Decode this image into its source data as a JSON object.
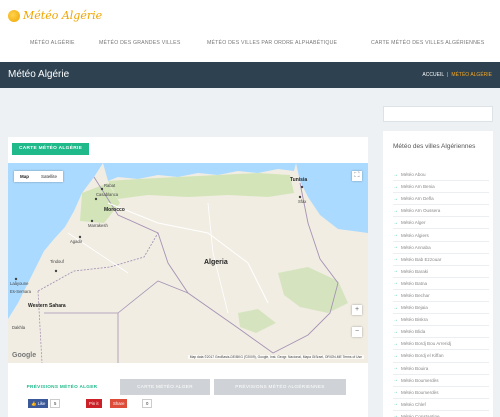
{
  "site": {
    "logo_text": "Météo Algérie"
  },
  "nav": [
    "MÉTÉO ALGÉRIE",
    "MÉTÉO DES GRANDES VILLES",
    "MÉTÉO DES VILLES PAR ORDRE ALPHABÉTIQUE",
    "CARTE MÉTÉO DES VILLES ALGÉRIENNES"
  ],
  "band": {
    "title": "Météo Algérie",
    "crumb_home": "ACCUEIL",
    "crumb_current": "MÉTÉO ALGÉRIE"
  },
  "map": {
    "tag": "CARTE MÉTÉO ALGÉRIE",
    "toggle_map": "Map",
    "toggle_satellite": "Satellite",
    "labels": {
      "algeria": "Algeria",
      "morocco": "Morocco",
      "western_sahara": "Western Sahara",
      "rabat": "Rabat",
      "casablanca": "Casablanca",
      "marrakesh": "Marrakesh",
      "agadir": "Agadir",
      "tunisia": "Tunisia",
      "sfax": "Sfax",
      "tindouf": "Tindouf",
      "laayoune": "Laâyoune",
      "es_semara": "Es-Semara",
      "dakhla": "Dakhla"
    },
    "google": "Google",
    "attribution": "Map data ©2017 GeoBasis-DE/BKG (©2009), Google, Inst. Geogr. Nacional, Mapa GISrael, ORION-ME   Terms of Use"
  },
  "tabs": [
    "PRÉVISIONS MÉTÉO ALGER",
    "CARTE MÉTÉO ALGER",
    "PRÉVISIONS MÉTÉO ALGÉRIENNES"
  ],
  "share": {
    "like": "Like",
    "like_count": "5",
    "pin": "Pin it",
    "share": "Share",
    "share_count": "0"
  },
  "sidebar": {
    "title": "Météo des villes Algériennes",
    "cities": [
      "Météo Abou",
      "Météo Aïn Benia",
      "Météo Aïn Defla",
      "Météo Aïn Oussera",
      "Météo Alger",
      "Météo Algiers",
      "Météo Annaba",
      "Météo Bab Ezzouar",
      "Météo Baraki",
      "Météo Batna",
      "Météo Bechar",
      "Météo Bejaia",
      "Météo Biskra",
      "Météo Blida",
      "Météo Bordj Bou Arreridj",
      "Météo Bordj el Kiffan",
      "Météo Bouira",
      "Météo Boumerdès",
      "Météo Boumerdès",
      "Météo Chlef",
      "Météo Constantine"
    ]
  },
  "colors": {
    "accent": "#1fb98a",
    "band": "#2d4150",
    "breadcrumb_active": "#f5a623",
    "facebook": "#3b5998",
    "pinterest": "#cb2027",
    "google_plus": "#dd4b39"
  }
}
